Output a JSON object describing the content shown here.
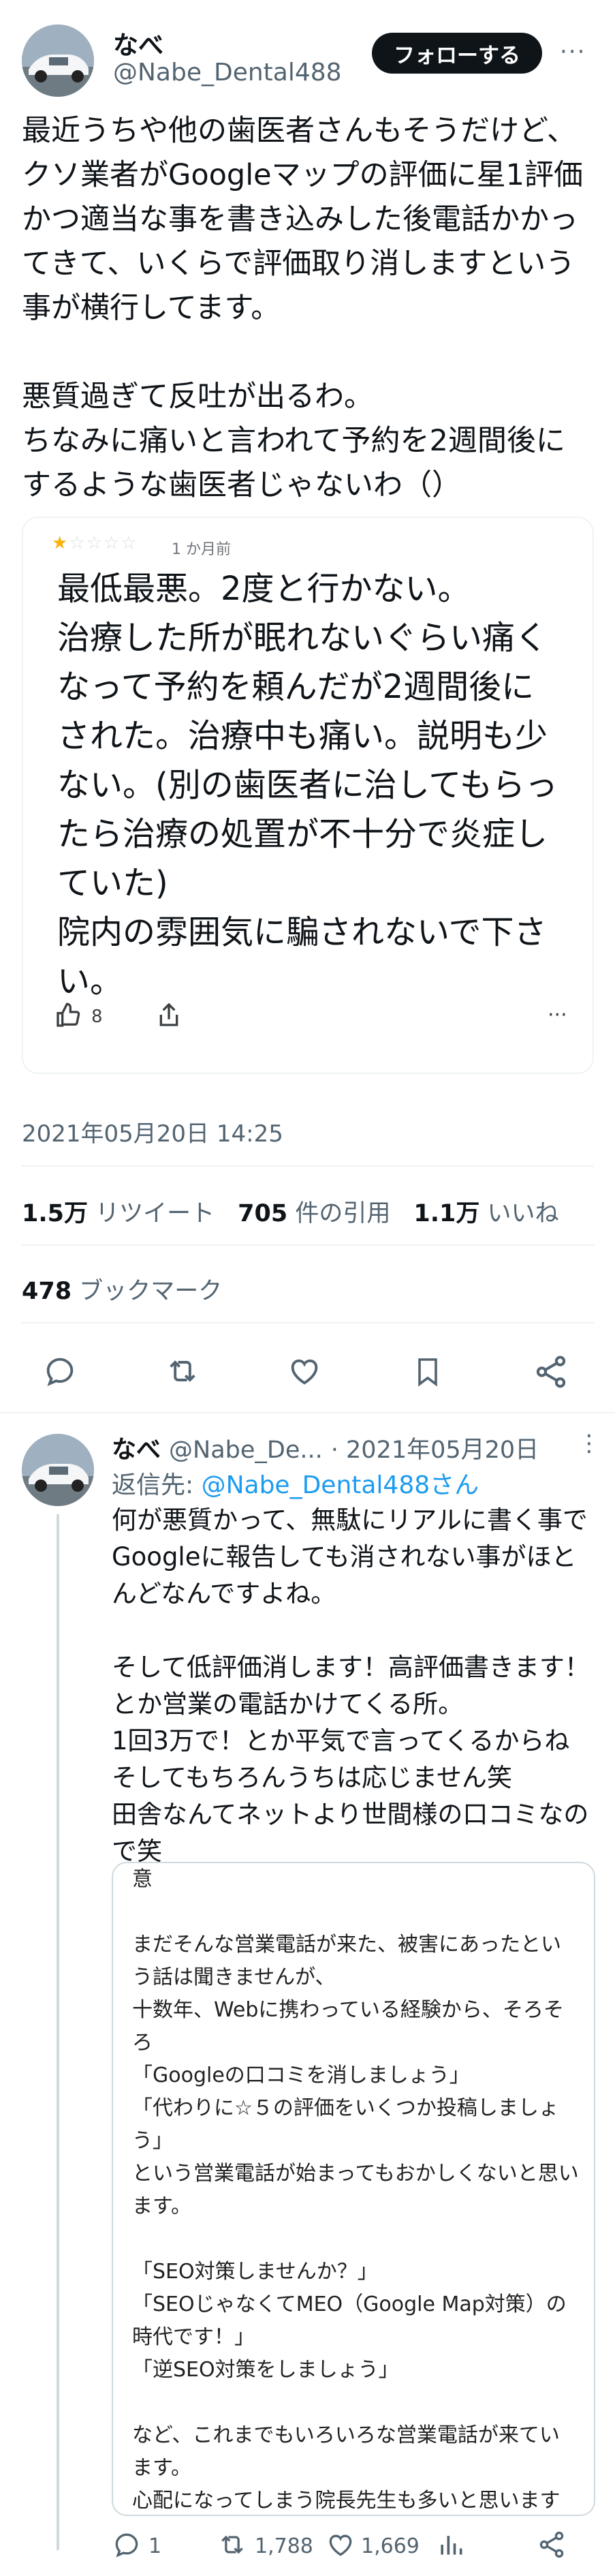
{
  "tweet": {
    "author_name": "なべ",
    "author_handle": "@Nabe_Dental488",
    "follow_label": "フォローする",
    "more_label": "···",
    "body": "最近うちや他の歯医者さんもそうだけど、クソ業者がGoogleマップの評価に星1評価かつ適当な事を書き込みした後電話かかってきて、いくらで評価取り消しますという事が横行してます。\n\n悪質過ぎて反吐が出るわ。\nちなみに痛いと言われて予約を2週間後にするような歯医者じゃないわ（）",
    "timestamp": "2021年05月20日 14:25",
    "stats": {
      "retweets_count": "1.5万",
      "retweets_label": "リツイート",
      "quotes_count": "705",
      "quotes_label": "件の引用",
      "likes_count": "1.1万",
      "likes_label": "いいね",
      "bookmarks_count": "478",
      "bookmarks_label": "ブックマーク"
    }
  },
  "review_card": {
    "stars": "★☆☆☆☆",
    "stars_value": 1,
    "time_ago": "1 か月前",
    "text": "最低最悪。2度と行かない。\n治療した所が眠れないぐらい痛くなって予約を頼んだが2週間後にされた。治療中も痛い。説明も少ない。(別の歯医者に治してもらったら治療の処置が不十分で炎症していた)\n院内の雰囲気に騙されないで下さい。",
    "helpful_count": "8",
    "more_label": "···"
  },
  "reply": {
    "author_name": "なべ",
    "author_handle": "@Nabe_De...",
    "date": "· 2021年05月20日",
    "more_label": "⋮",
    "replying_to_prefix": "返信先: ",
    "replying_to_handle": "@Nabe_Dental488さん",
    "body": "何が悪質かって、無駄にリアルに書く事でGoogleに報告しても消されない事がほとんどなんですよね。\n\nそして低評価消します！高評価書きます！とか営業の電話かけてくる所。\n1回3万で！とか平気で言ってくるからね\nそしてもちろんうちは応じません笑\n田舎なんてネットより世間様の口コミなので笑",
    "quote": {
      "text": "意\n\nまだそんな営業電話が来た、被害にあったという話は聞きませんが、\n十数年、Webに携わっている経験から、そろそろ\n「Googleの口コミを消しましょう」\n「代わりに☆５の評価をいくつか投稿しましょう」\nという営業電話が始まってもおかしくないと思います。\n\n「SEO対策しませんか？」\n「SEOじゃなくてMEO（Google Map対策）の時代です！」\n「逆SEO対策をしましょう」\n\nなど、これまでもいろいろな営業電話が来ています。\n心配になってしまう院長先生も多いと思いますが、この手の営業電話で効果があったという話はほぼ聞きませんので、ご注意ください。"
    },
    "actions": {
      "replies": "1",
      "retweets": "1,788",
      "likes": "1,669"
    }
  },
  "colors": {
    "text": "#0f1419",
    "muted": "#536471",
    "link": "#1d9bf0",
    "star": "#f9b208",
    "border": "#eff3f4"
  }
}
